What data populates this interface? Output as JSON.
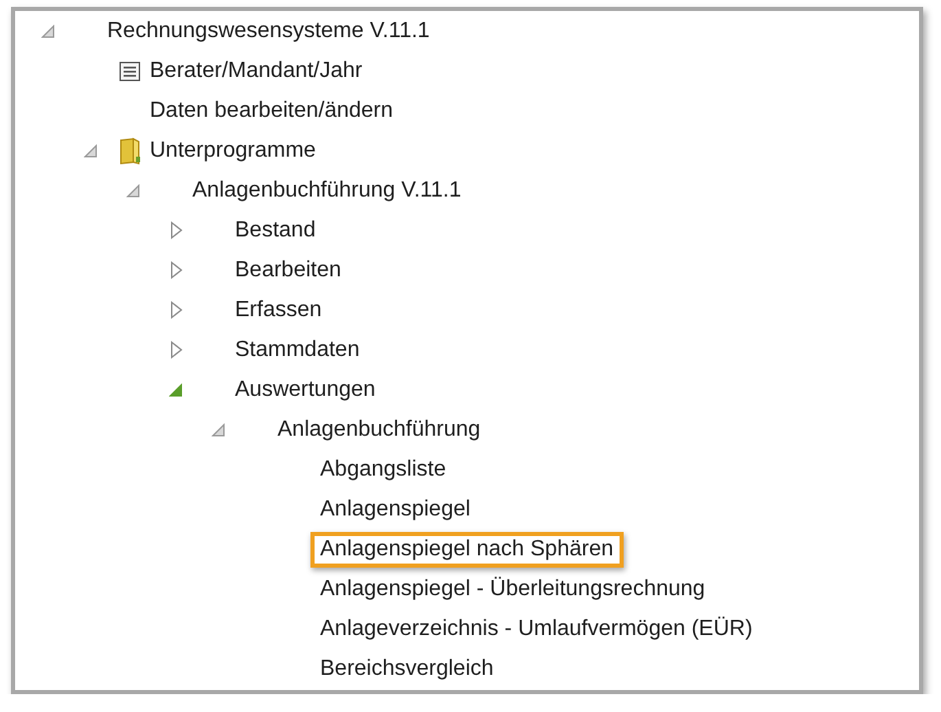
{
  "tree": [
    {
      "label": "Rechnungswesensysteme V.11.1",
      "expanded": true,
      "children": [
        {
          "label": "Berater/Mandant/Jahr",
          "kind": "list"
        },
        {
          "label": "Daten bearbeiten/ändern"
        },
        {
          "label": "Unterprogramme",
          "kind": "folder",
          "expanded": true,
          "children": [
            {
              "label": "Anlagenbuchführung V.11.1",
              "expanded": true,
              "children": [
                {
                  "label": "Bestand",
                  "expanded": false,
                  "hovered": false
                },
                {
                  "label": "Bearbeiten",
                  "expanded": false,
                  "hovered": false
                },
                {
                  "label": "Erfassen",
                  "expanded": false,
                  "hovered": false
                },
                {
                  "label": "Stammdaten",
                  "expanded": false,
                  "hovered": false
                },
                {
                  "label": "Auswertungen",
                  "expanded": true,
                  "hovered": true,
                  "children": [
                    {
                      "label": "Anlagenbuchführung",
                      "expanded": true,
                      "children": [
                        {
                          "label": "Abgangsliste",
                          "marked": false
                        },
                        {
                          "label": "Anlagenspiegel",
                          "marked": false
                        },
                        {
                          "label": "Anlagenspiegel nach Sphären",
                          "marked": true
                        },
                        {
                          "label": "Anlagenspiegel - Überleitungsrechnung",
                          "marked": false
                        },
                        {
                          "label": "Anlageverzeichnis - Umlaufvermögen (EÜR)",
                          "marked": false
                        },
                        {
                          "label": "Bereichsvergleich",
                          "marked": false
                        }
                      ]
                    }
                  ]
                }
              ]
            }
          ]
        }
      ]
    }
  ]
}
